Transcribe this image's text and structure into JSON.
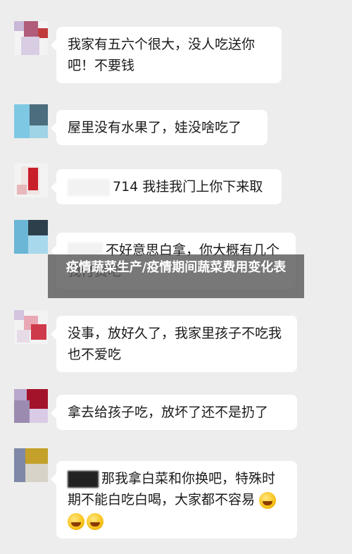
{
  "messages": [
    {
      "text": "我家有五六个很大，没人吃送你吧！不要钱"
    },
    {
      "text": "屋里没有水果了，娃没啥吃了"
    },
    {
      "text": "714  我挂我门上你下来取"
    },
    {
      "text": "不好意思白拿，你大概有几个我付费吧"
    },
    {
      "text": "没事，放好久了，我家里孩子不吃我也不爱吃"
    },
    {
      "text": "拿去给孩子吃，放坏了还不是扔了"
    },
    {
      "text": "那我拿白菜和你换吧，特殊时期不能白吃白喝，大家都不容易"
    }
  ],
  "overlay_title": "疫情蔬菜生产/疫情期间蔬菜费用变化表"
}
